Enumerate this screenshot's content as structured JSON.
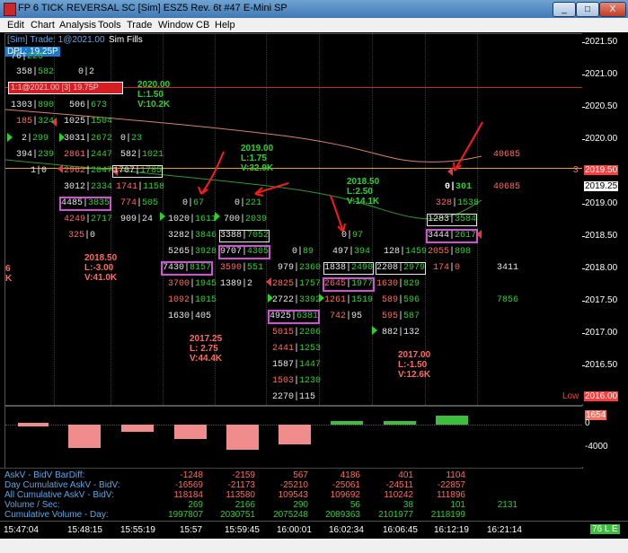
{
  "window": {
    "title": "FP 6 TICK REVERSAL  SC [Sim] ESZ5  Rev. 6t  #47  E-Mini SP",
    "minimize": "_",
    "maximize": "□",
    "close": "X"
  },
  "menu": [
    "Edit",
    "Chart",
    "Analysis",
    "Tools",
    "Trade",
    "Window",
    "CB",
    "Help"
  ],
  "header": {
    "sim_label": "[Sim]  Trade: 1@2021.00",
    "sim_fills": "Sim Fills",
    "dpl": "DPL: 19.25P",
    "red_bar_text": "1:1@2021.00  [3] 19.75P"
  },
  "price_axis": {
    "labels": [
      "2021.50",
      "2021.00",
      "2020.50",
      "2020.00",
      "2019.50",
      "2019.00",
      "2018.50",
      "2018.00",
      "2017.50",
      "2017.00",
      "2016.50"
    ],
    "current_price": "2019.25",
    "marker_label": "3",
    "marker_price": "2019.50",
    "low_label": "Low",
    "low_price": "2016.00",
    "colors": {
      "current_box": "#ffffff",
      "marker_box": "#ff3b3b",
      "low_box": "#ff3b3b"
    }
  },
  "sub_scale": {
    "top": "1654",
    "zero": "0",
    "bottom": "-4000"
  },
  "right_side_numbers": [
    "40685",
    "40685",
    "3411",
    "7856"
  ],
  "annotations": [
    {
      "text": [
        "2020.00",
        "L:1.50",
        "V:10.2K"
      ],
      "color": "#2bd22b"
    },
    {
      "text": [
        "2019.00",
        "L:1.75",
        "V:32.9K"
      ],
      "color": "#2bd22b"
    },
    {
      "text": [
        "2018.50",
        "L:2.50",
        "V:14.1K"
      ],
      "color": "#2bd22b"
    },
    {
      "text": [
        "2018.50",
        "L:-3.00",
        "V:41.0K"
      ],
      "color": "#ff6b5f"
    },
    {
      "text": [
        "2017.25",
        "L: 2.75",
        "V:44.4K"
      ],
      "color": "#ff6b5f"
    },
    {
      "text": [
        "2017.00",
        "L:-1.50",
        "V:12.6K"
      ],
      "color": "#ff6b5f"
    },
    {
      "text": [
        "6",
        "K"
      ],
      "color": "#ff6b5f"
    }
  ],
  "cells": [
    [
      "76",
      "225"
    ],
    [
      "358",
      "582"
    ],
    [
      "0",
      "2"
    ],
    [
      "1303",
      "890"
    ],
    [
      "506",
      "673"
    ],
    [
      "185",
      "324"
    ],
    [
      "1025",
      "1504"
    ],
    [
      "2",
      "299"
    ],
    [
      "3031",
      "2672"
    ],
    [
      "0",
      "23"
    ],
    [
      "394",
      "239"
    ],
    [
      "2861",
      "2447"
    ],
    [
      "582",
      "1021"
    ],
    [
      "1",
      "0"
    ],
    [
      "2962",
      "2047"
    ],
    [
      "1707",
      "1785"
    ],
    [
      "3012",
      "2334"
    ],
    [
      "1741",
      "1158"
    ],
    [
      "4485",
      "3835"
    ],
    [
      "774",
      "505"
    ],
    [
      "0",
      "67"
    ],
    [
      "0",
      "221"
    ],
    [
      "4249",
      "2717"
    ],
    [
      "909",
      "24"
    ],
    [
      "1020",
      "1611"
    ],
    [
      "700",
      "2039"
    ],
    [
      "325",
      "0"
    ],
    [
      "3282",
      "3846"
    ],
    [
      "3388",
      "7052"
    ],
    [
      "0",
      "301"
    ],
    [
      "328",
      "1538"
    ],
    [
      "5265",
      "3928"
    ],
    [
      "9707",
      "4305"
    ],
    [
      "0",
      "89"
    ],
    [
      "497",
      "394"
    ],
    [
      "128",
      "1459"
    ],
    [
      "1283",
      "3584"
    ],
    [
      "7430",
      "8157"
    ],
    [
      "3590",
      "551"
    ],
    [
      "979",
      "2360"
    ],
    [
      "1838",
      "2490"
    ],
    [
      "2208",
      "2979"
    ],
    [
      "0",
      "97"
    ],
    [
      "3444",
      "2617"
    ],
    [
      "3700",
      "1945"
    ],
    [
      "1389",
      "2"
    ],
    [
      "2825",
      "1757"
    ],
    [
      "2645",
      "1977"
    ],
    [
      "1630",
      "829"
    ],
    [
      "2055",
      "898"
    ],
    [
      "1092",
      "1015"
    ],
    [
      "2722",
      "3392"
    ],
    [
      "1261",
      "1519"
    ],
    [
      "589",
      "596"
    ],
    [
      "174",
      "0"
    ],
    [
      "1630",
      "405"
    ],
    [
      "4925",
      "6381"
    ],
    [
      "742",
      "95"
    ],
    [
      "595",
      "587"
    ],
    [
      "5015",
      "2206"
    ],
    [
      "882",
      "132"
    ],
    [
      "2441",
      "1253"
    ],
    [
      "1587",
      "1447"
    ],
    [
      "1503",
      "1230"
    ],
    [
      "2270",
      "115"
    ]
  ],
  "stats": {
    "labels": [
      "AskV - BidV BarDiff:",
      "Day Cumulative AskV - BidV:",
      "All Cumulative AskV - BidV:",
      "Volume / Sec:",
      "Cumulative Volume - Day:"
    ],
    "rows": [
      [
        "-1248",
        "-2159",
        "567",
        "4186",
        "401",
        "1104"
      ],
      [
        "-16569",
        "-21173",
        "-25210",
        "-25061",
        "-24511",
        "-22857"
      ],
      [
        "118184",
        "113580",
        "109543",
        "109692",
        "110242",
        "111896"
      ],
      [
        "269",
        "2166",
        "290",
        "56",
        "38",
        "101",
        "2131"
      ],
      [
        "1997807",
        "2030751",
        "2075248",
        "2089363",
        "2101977",
        "2118199"
      ]
    ]
  },
  "time_axis": [
    "15:47:04",
    "15:48:15",
    "15:55:19",
    "15:57",
    "15:59:45",
    "16:00:01",
    "16:02:34",
    "16:06:45",
    "16:12:19",
    "16:21:14"
  ],
  "status": {
    "badge": "76 L E"
  }
}
